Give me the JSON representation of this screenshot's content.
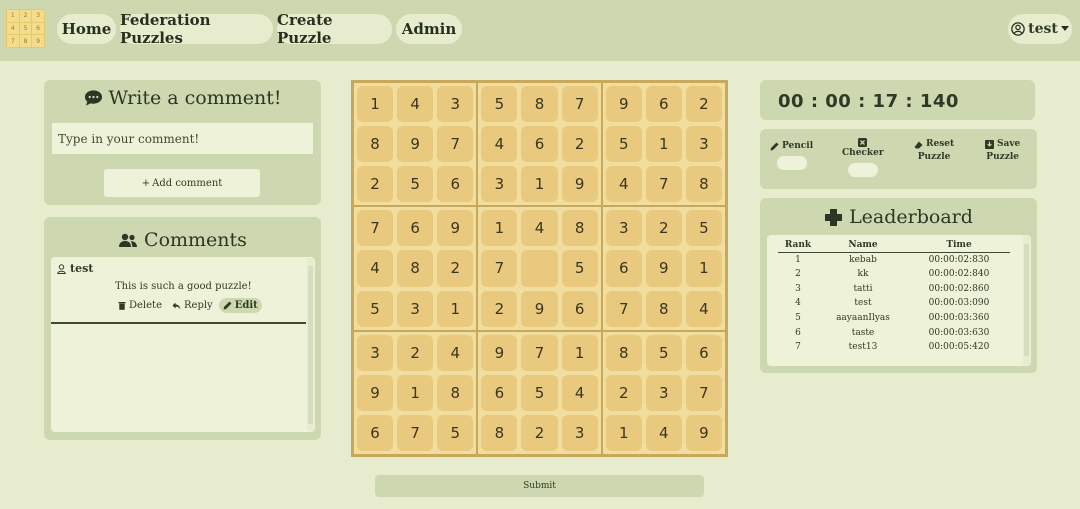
{
  "nav": {
    "logo_digits": [
      "1",
      "2",
      "3",
      "4",
      "5",
      "6",
      "7",
      "8",
      "9"
    ],
    "items": [
      {
        "label": "Home"
      },
      {
        "label": "Federation Puzzles"
      },
      {
        "label": "Create Puzzle"
      },
      {
        "label": "Admin"
      }
    ],
    "user": {
      "name": "test",
      "icon": "user-circle-icon",
      "caret": "caret-down-icon"
    }
  },
  "write_comment": {
    "title": "Write a comment!",
    "icon": "comment-icon",
    "placeholder": "Type in your comment!",
    "add_label": "Add comment"
  },
  "comments": {
    "title": "Comments",
    "icon": "users-icon",
    "items": [
      {
        "author": "test",
        "text": "This is such a good puzzle!",
        "delete_label": "Delete",
        "reply_label": "Reply",
        "edit_label": "Edit"
      }
    ]
  },
  "sudoku": {
    "rows": [
      [
        "1",
        "4",
        "3",
        "5",
        "8",
        "7",
        "9",
        "6",
        "2"
      ],
      [
        "8",
        "9",
        "7",
        "4",
        "6",
        "2",
        "5",
        "1",
        "3"
      ],
      [
        "2",
        "5",
        "6",
        "3",
        "1",
        "9",
        "4",
        "7",
        "8"
      ],
      [
        "7",
        "6",
        "9",
        "1",
        "4",
        "8",
        "3",
        "2",
        "5"
      ],
      [
        "4",
        "8",
        "2",
        "7",
        "",
        "5",
        "6",
        "9",
        "1"
      ],
      [
        "5",
        "3",
        "1",
        "2",
        "9",
        "6",
        "7",
        "8",
        "4"
      ],
      [
        "3",
        "2",
        "4",
        "9",
        "7",
        "1",
        "8",
        "5",
        "6"
      ],
      [
        "9",
        "1",
        "8",
        "6",
        "5",
        "4",
        "2",
        "3",
        "7"
      ],
      [
        "6",
        "7",
        "5",
        "8",
        "2",
        "3",
        "1",
        "4",
        "9"
      ]
    ],
    "submit_label": "Submit"
  },
  "timer": {
    "value": "00 : 00 : 17 : 140"
  },
  "tools": {
    "pencil_label": "Pencil",
    "checker_label": "Checker",
    "reset_label_1": "Reset",
    "reset_label_2": "Puzzle",
    "save_label_1": "Save",
    "save_label_2": "Puzzle"
  },
  "leaderboard": {
    "title": "Leaderboard",
    "icon": "puzzle-piece-icon",
    "headers": [
      "Rank",
      "Name",
      "Time"
    ],
    "rows": [
      [
        "1",
        "kebab",
        "00:00:02:830"
      ],
      [
        "2",
        "kk",
        "00:00:02:840"
      ],
      [
        "3",
        "tatti",
        "00:00:02:860"
      ],
      [
        "4",
        "test",
        "00:00:03:090"
      ],
      [
        "5",
        "aayaanIlyas",
        "00:00:03:360"
      ],
      [
        "6",
        "taste",
        "00:00:03:630"
      ],
      [
        "7",
        "test13",
        "00:00:05:420"
      ]
    ]
  },
  "colors": {
    "background": "#e6eccd",
    "panel": "#cdd8b1",
    "board_border": "#c8a85a",
    "box_fill": "#f1de9f",
    "cell_fill": "#e8c97d"
  }
}
